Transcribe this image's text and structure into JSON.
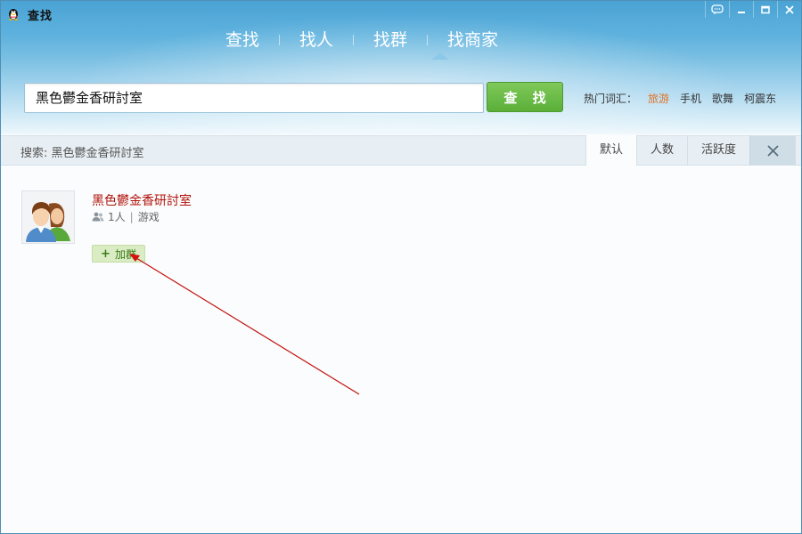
{
  "window": {
    "title": "查找",
    "controls": [
      "feedback-icon",
      "minimize-icon",
      "maximize-icon",
      "close-icon"
    ]
  },
  "nav": {
    "tabs": [
      {
        "label": "查找"
      },
      {
        "label": "找人"
      },
      {
        "label": "找群",
        "selected": true
      },
      {
        "label": "找商家"
      }
    ]
  },
  "search": {
    "value": "黑色鬱金香研討室",
    "button_label": "查 找",
    "hot_label": "热门词汇：",
    "hot_words": [
      "旅游",
      "手机",
      "歌舞",
      "柯震东"
    ]
  },
  "filter": {
    "text": "搜索: 黑色鬱金香研討室",
    "sort_options": [
      {
        "label": "默认",
        "active": true
      },
      {
        "label": "人数"
      },
      {
        "label": "活跃度"
      }
    ]
  },
  "results": [
    {
      "name": "黑色鬱金香研討室",
      "members": "1人",
      "category": "游戏",
      "join_label": "加群"
    }
  ],
  "colors": {
    "accent_green": "#5aaf39",
    "group_name": "#b0140c",
    "hot_highlight": "#e0732a",
    "annotation_arrow": "#c0100c"
  }
}
